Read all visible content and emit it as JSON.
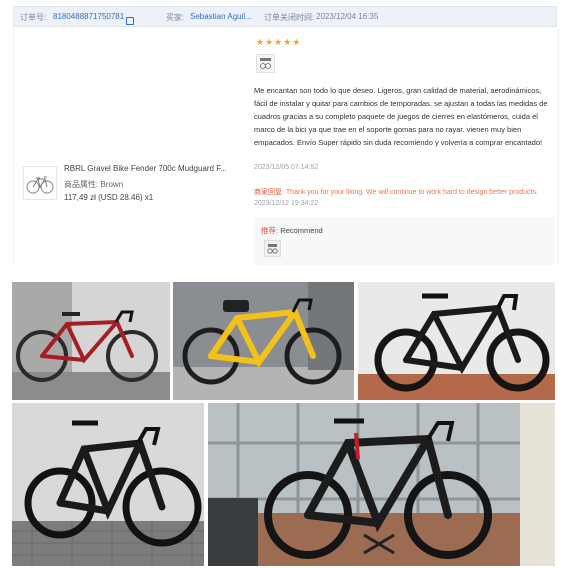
{
  "order": {
    "number_label": "订单号:",
    "number": "8180488871750781",
    "buyer_label": "买家:",
    "buyer": "Sebastian Aguil...",
    "time_label": "订单关闭时间:",
    "time": "2023/12/04 16:35"
  },
  "product": {
    "title": "RBRL Gravel Bike Fender 700c Mudguard F...",
    "attr_label": "商品属性:",
    "attr_value": "Brown",
    "price": "117,49 zł (USD 28.46)",
    "quantity": "x1"
  },
  "review": {
    "stars": "★★★★★",
    "text": "Me encantan son todo lo que deseo. Ligeros, gran calidad de material, aerodinámicos, fácil de instalar y quitar para cambios de temporadas. se ajustan a todas las medidas de cuadros gracias a su completo paquete de juegos de cierres en elastómeros, cuida el marco de la bici ya que trae en el soporte gomas para no rayar. vienen muy bien empacados. Envío Super rápido sin duda recomiendo y volvería a comprar encantado!",
    "date": "2023/12/05 07:14:52",
    "reply_label": "商家回复:",
    "reply_text": "Thank you for your liking. We will continue to work hard to design better products.",
    "reply_date": "2023/12/12 19:34:22",
    "recommend_label": "推荐:",
    "recommend_value": "Recommend"
  },
  "colors": {
    "link": "#2e6fc9",
    "accent": "#e05a36",
    "star": "#f5a623"
  }
}
